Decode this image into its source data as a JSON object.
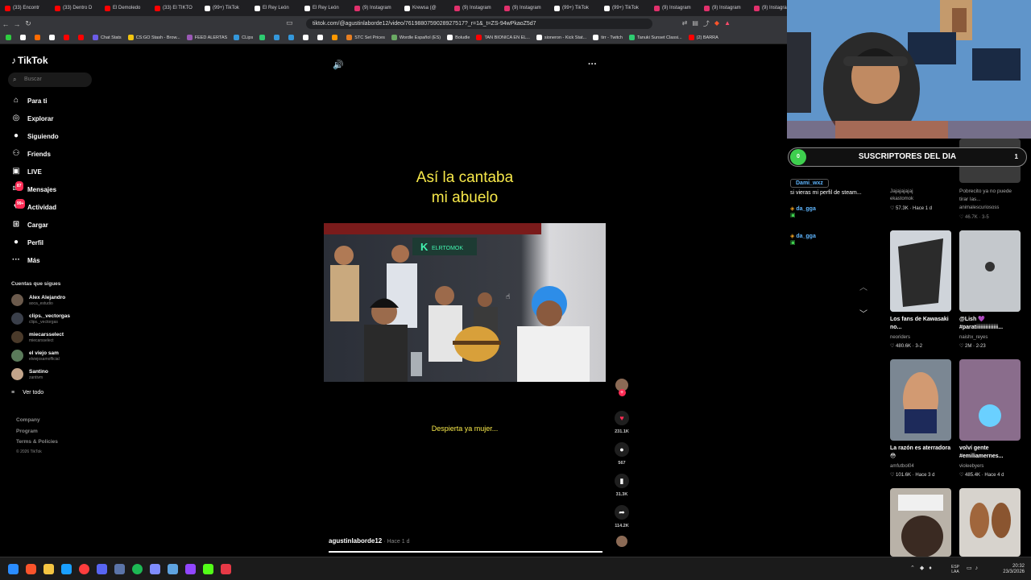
{
  "browser": {
    "tabs": [
      {
        "label": "(33) Encontr",
        "color": "#ff0000"
      },
      {
        "label": "(33) Dentro D",
        "color": "#ff0000"
      },
      {
        "label": "El Demoledo",
        "color": "#ff0000"
      },
      {
        "label": "(33) El TIKTO",
        "color": "#ff0000"
      },
      {
        "label": "(99+) TikTok",
        "color": "#ffffff"
      },
      {
        "label": "El Rey León",
        "color": "#ffffff"
      },
      {
        "label": "El Rey León",
        "color": "#ffffff"
      },
      {
        "label": "(9) Instagram",
        "color": "#e1306c"
      },
      {
        "label": "Krewsa (@",
        "color": "#ffffff"
      },
      {
        "label": "(9) Instagram",
        "color": "#e1306c"
      },
      {
        "label": "(9) Instagram",
        "color": "#e1306c"
      },
      {
        "label": "(99+) TikTok",
        "color": "#ffffff"
      },
      {
        "label": "(99+) TikTok",
        "color": "#ffffff"
      },
      {
        "label": "(9) Instagram",
        "color": "#e1306c"
      },
      {
        "label": "(9) Instagram",
        "color": "#e1306c"
      },
      {
        "label": "(9) Instagram",
        "color": "#e1306c"
      }
    ],
    "url": "tiktok.com/@agustinlaborde12/video/7619880759028927517?_r=1&_t=ZS-94wPkaoZ5d7",
    "bookmarks": [
      {
        "label": "",
        "color": "#2ecc40"
      },
      {
        "label": "",
        "color": "#ffffff"
      },
      {
        "label": "",
        "color": "#ff6b00"
      },
      {
        "label": "",
        "color": "#ffffff"
      },
      {
        "label": "",
        "color": "#ff0000"
      },
      {
        "label": "",
        "color": "#ff0000"
      },
      {
        "label": "Chat Stats",
        "color": "#6c5ce7"
      },
      {
        "label": "CS:GO Stash - Brow...",
        "color": "#f1c40f"
      },
      {
        "label": "FEED ALERTAS",
        "color": "#9b59b6"
      },
      {
        "label": "CLips",
        "color": "#3498db"
      },
      {
        "label": "",
        "color": "#2ecc71"
      },
      {
        "label": "",
        "color": "#3498db"
      },
      {
        "label": "",
        "color": "#3498db"
      },
      {
        "label": "",
        "color": "#ffffff"
      },
      {
        "label": "",
        "color": "#ffffff"
      },
      {
        "label": "",
        "color": "#ff9800"
      },
      {
        "label": "STC Set Prices",
        "color": "#e67e22"
      },
      {
        "label": "Wordle Español (ES)",
        "color": "#6aaa64"
      },
      {
        "label": "Boludle",
        "color": "#ffffff"
      },
      {
        "label": "TAN BIONICA EN EL...",
        "color": "#ff0000"
      },
      {
        "label": "sioneron - Kick Stat...",
        "color": "#ffffff"
      },
      {
        "label": "tirr - Twitch",
        "color": "#ffffff"
      },
      {
        "label": "Tanuki Sunset Classi...",
        "color": "#2ecc71"
      },
      {
        "label": "(2) BARRA",
        "color": "#ff0000"
      }
    ]
  },
  "sidebar": {
    "logo": "TikTok",
    "search_placeholder": "Buscar",
    "nav": [
      {
        "label": "Para ti",
        "icon": "home-icon",
        "glyph": "⌂"
      },
      {
        "label": "Explorar",
        "icon": "compass-icon",
        "glyph": "◎"
      },
      {
        "label": "Siguiendo",
        "icon": "following-icon",
        "glyph": "●"
      },
      {
        "label": "Friends",
        "icon": "friends-icon",
        "glyph": "⚇"
      },
      {
        "label": "LIVE",
        "icon": "live-icon",
        "glyph": "▣"
      },
      {
        "label": "Mensajes",
        "icon": "messages-icon",
        "glyph": "✉",
        "badge": "87"
      },
      {
        "label": "Actividad",
        "icon": "activity-icon",
        "glyph": "♥",
        "badge": "99+"
      },
      {
        "label": "Cargar",
        "icon": "upload-icon",
        "glyph": "⊞"
      },
      {
        "label": "Perfil",
        "icon": "profile-icon",
        "glyph": "●"
      },
      {
        "label": "Más",
        "icon": "more-icon",
        "glyph": "···"
      }
    ],
    "following_title": "Cuentas que sigues",
    "accounts": [
      {
        "name": "Alex Alejandro",
        "handle": "aoca_estudio"
      },
      {
        "name": "clips._vectorgas",
        "handle": "clips._vectorgas"
      },
      {
        "name": "miecarsselect",
        "handle": "miecarsselect"
      },
      {
        "name": "el viejo sam",
        "handle": "elviejosamofficial"
      },
      {
        "name": "Santino",
        "handle": "zantivm"
      }
    ],
    "see_all": "Ver todo",
    "footer": [
      "Company",
      "Program",
      "Terms & Policies"
    ],
    "copyright": "© 2026 TikTok"
  },
  "video": {
    "title_line1": "Así la cantaba",
    "title_line2": "mi abuelo",
    "subtitle": "Despierta ya mujer...",
    "author": "agustinlaborde12",
    "time": " · Hace 1 d",
    "progress": 1.0,
    "actions": {
      "likes": "231.1K",
      "comments": "567",
      "saves": "31.3K",
      "shares": "114.2K"
    }
  },
  "stream": {
    "subs_title": "SUSCRIPTORES DEL DIA",
    "subs_left": "0",
    "subs_right": "1",
    "chat": [
      {
        "user": "Dami_wxz",
        "text": "si vieras mi perfil de steam..."
      },
      {
        "user": "da_gga",
        "text": ""
      },
      {
        "user": "da_gga",
        "text": ""
      }
    ]
  },
  "related": [
    {
      "caption": "Jajajajajaj",
      "user": "ekastomok",
      "stats": "♡ 57.3K · Hace 1 d"
    },
    {
      "caption": "Pobrecito ya no puede tirar las...",
      "user": "animalescuriososs",
      "stats": "♡ 46.7K · 3-5"
    },
    {
      "caption": "Los fans de Kawasaki no...",
      "user": "neoriders",
      "stats": "♡ 480.6K · 3-2"
    },
    {
      "caption": "@Lish 💜 #paratiiiiiiiiiiiiii...",
      "user": "naishx_reyes",
      "stats": "♡ 2M · 2-23"
    },
    {
      "caption": "La razón es aterradora 😳",
      "user": "amfutbol04",
      "stats": "♡ 101.6K · Hace 3 d"
    },
    {
      "caption": "volví gente #emiliamernes...",
      "user": "violeebyers",
      "stats": "♡ 485.4K · Hace 4 d"
    }
  ],
  "taskbar": {
    "lang": "ESP",
    "lang2": "LAA",
    "time": "20:32",
    "date": "23/3/2026"
  }
}
